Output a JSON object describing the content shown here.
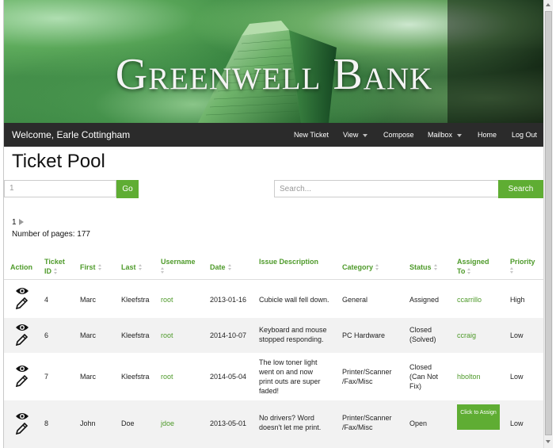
{
  "banner": {
    "title": "Greenwell Bank"
  },
  "nav": {
    "welcome": "Welcome, Earle Cottingham",
    "new_ticket": "New Ticket",
    "view": "View",
    "compose": "Compose",
    "mailbox": "Mailbox",
    "home": "Home",
    "logout": "Log Out"
  },
  "page_title": "Ticket Pool",
  "filter": {
    "page_input_value": "1",
    "go_label": "Go",
    "search_placeholder": "Search...",
    "search_label": "Search"
  },
  "pagination": {
    "current_page": "1",
    "pages_text": "Number of pages: 177"
  },
  "table": {
    "headers": {
      "action": "Action",
      "ticket_id": "Ticket ID",
      "first": "First",
      "last": "Last",
      "username": "Username",
      "date": "Date",
      "issue": "Issue Description",
      "category": "Category",
      "status": "Status",
      "assigned": "Assigned To",
      "priority": "Priority"
    },
    "rows": [
      {
        "id": "4",
        "first": "Marc",
        "last": "Kleefstra",
        "username": "root",
        "date": "2013-01-16",
        "issue": "Cubicle wall fell down.",
        "category": "General",
        "status": "Assigned",
        "assigned": "ccarrillo",
        "priority": "High"
      },
      {
        "id": "6",
        "first": "Marc",
        "last": "Kleefstra",
        "username": "root",
        "date": "2014-10-07",
        "issue": "Keyboard and mouse stopped responding.",
        "category": "PC Hardware",
        "status": "Closed (Solved)",
        "assigned": "ccraig",
        "priority": "Low"
      },
      {
        "id": "7",
        "first": "Marc",
        "last": "Kleefstra",
        "username": "root",
        "date": "2014-05-04",
        "issue": "The low toner light went on and now print outs are super faded!",
        "category": "Printer/Scanner /Fax/Misc",
        "status": "Closed (Can Not Fix)",
        "assigned": "hbolton",
        "priority": "Low"
      },
      {
        "id": "8",
        "first": "John",
        "last": "Doe",
        "username": "jdoe",
        "date": "2013-05-01",
        "issue": "No drivers? Word doesn't let me print.",
        "category": "Printer/Scanner /Fax/Misc",
        "status": "Open",
        "assign_button": "Click to Assign",
        "priority": "Low"
      }
    ]
  }
}
